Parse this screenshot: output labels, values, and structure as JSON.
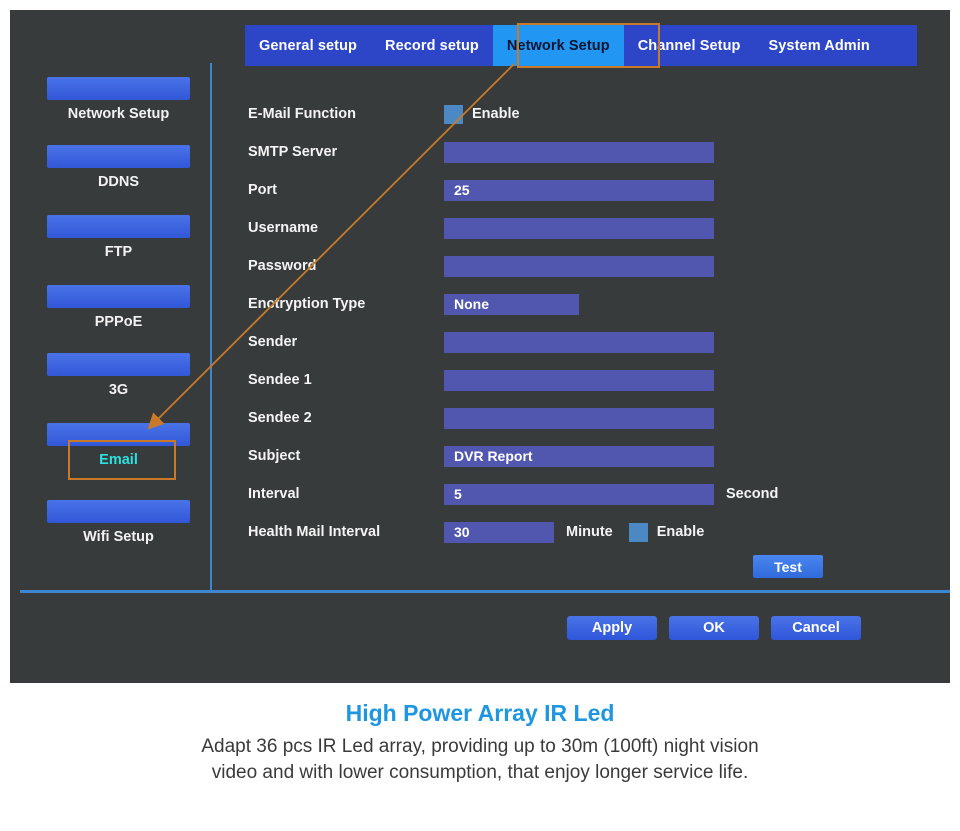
{
  "tabs": [
    {
      "label": "General setup",
      "active": false
    },
    {
      "label": "Record setup",
      "active": false
    },
    {
      "label": "Network Setup",
      "active": true
    },
    {
      "label": "Channel Setup",
      "active": false
    },
    {
      "label": "System Admin",
      "active": false
    }
  ],
  "sidebar": {
    "items": [
      {
        "label": "Network Setup",
        "selected": false
      },
      {
        "label": "DDNS",
        "selected": false
      },
      {
        "label": "FTP",
        "selected": false
      },
      {
        "label": "PPPoE",
        "selected": false
      },
      {
        "label": "3G",
        "selected": false
      },
      {
        "label": "Email",
        "selected": true
      },
      {
        "label": "Wifi Setup",
        "selected": false
      }
    ]
  },
  "form": {
    "rows": [
      {
        "label": "E-Mail Function",
        "type": "checkbox",
        "checked": true,
        "suffix": "Enable"
      },
      {
        "label": "SMTP Server",
        "type": "text",
        "value": ""
      },
      {
        "label": "Port",
        "type": "text",
        "value": "25"
      },
      {
        "label": "Username",
        "type": "text",
        "value": ""
      },
      {
        "label": "Password",
        "type": "text",
        "value": ""
      },
      {
        "label": "Enctryption Type",
        "type": "select",
        "value": "None"
      },
      {
        "label": "Sender",
        "type": "text",
        "value": ""
      },
      {
        "label": "Sendee 1",
        "type": "text",
        "value": ""
      },
      {
        "label": "Sendee 2",
        "type": "text",
        "value": ""
      },
      {
        "label": "Subject",
        "type": "text",
        "value": "DVR Report"
      },
      {
        "label": "Interval",
        "type": "text",
        "value": "5",
        "suffix": "Second"
      },
      {
        "label": "Health Mail Interval",
        "type": "short",
        "value": "30",
        "suffix": "Minute",
        "checkbox": true,
        "checkbox_label": "Enable"
      }
    ],
    "test_label": "Test"
  },
  "footer": {
    "buttons": [
      {
        "label": "Apply"
      },
      {
        "label": "OK"
      },
      {
        "label": "Cancel"
      }
    ]
  },
  "caption": {
    "title": "High Power Array IR Led",
    "line1": "Adapt 36 pcs IR Led array, providing up to 30m (100ft) night vision",
    "line2": "video and with lower consumption, that enjoy longer service life."
  },
  "annotation": {
    "color": "#c87a2a"
  }
}
